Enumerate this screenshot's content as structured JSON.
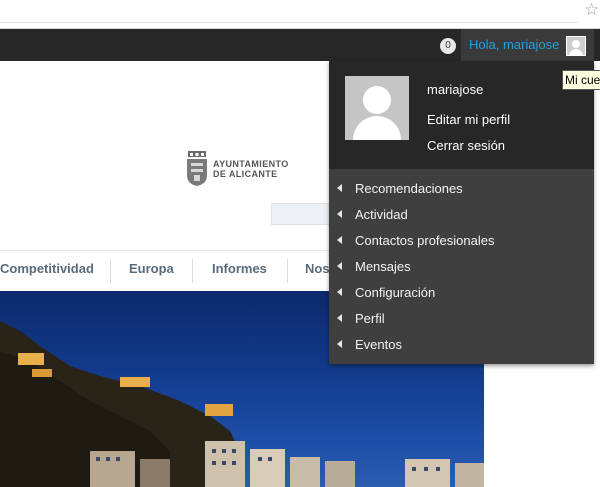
{
  "browser": {
    "bookmark_icon": "star-outline-icon"
  },
  "admin_bar": {
    "notification_count": "0",
    "greeting": "Hola, mariajose",
    "avatar_icon": "user-avatar-icon"
  },
  "tooltip": "Mi cue",
  "site": {
    "logo_line1": "AYUNTAMIENTO",
    "logo_line2": "DE ALICANTE",
    "nav": [
      "Competitividad",
      "Europa",
      "Informes",
      "Nos"
    ]
  },
  "user_menu": {
    "username": "mariajose",
    "edit_profile": "Editar mi perfil",
    "logout": "Cerrar sesión",
    "items": [
      "Recomendaciones",
      "Actividad",
      "Contactos profesionales",
      "Mensajes",
      "Configuración",
      "Perfil",
      "Eventos"
    ]
  },
  "colors": {
    "admin_bar": "#272727",
    "greeting": "#21a0d8",
    "menu_bg": "#3f3f3f",
    "nav_text": "#596b7a"
  }
}
